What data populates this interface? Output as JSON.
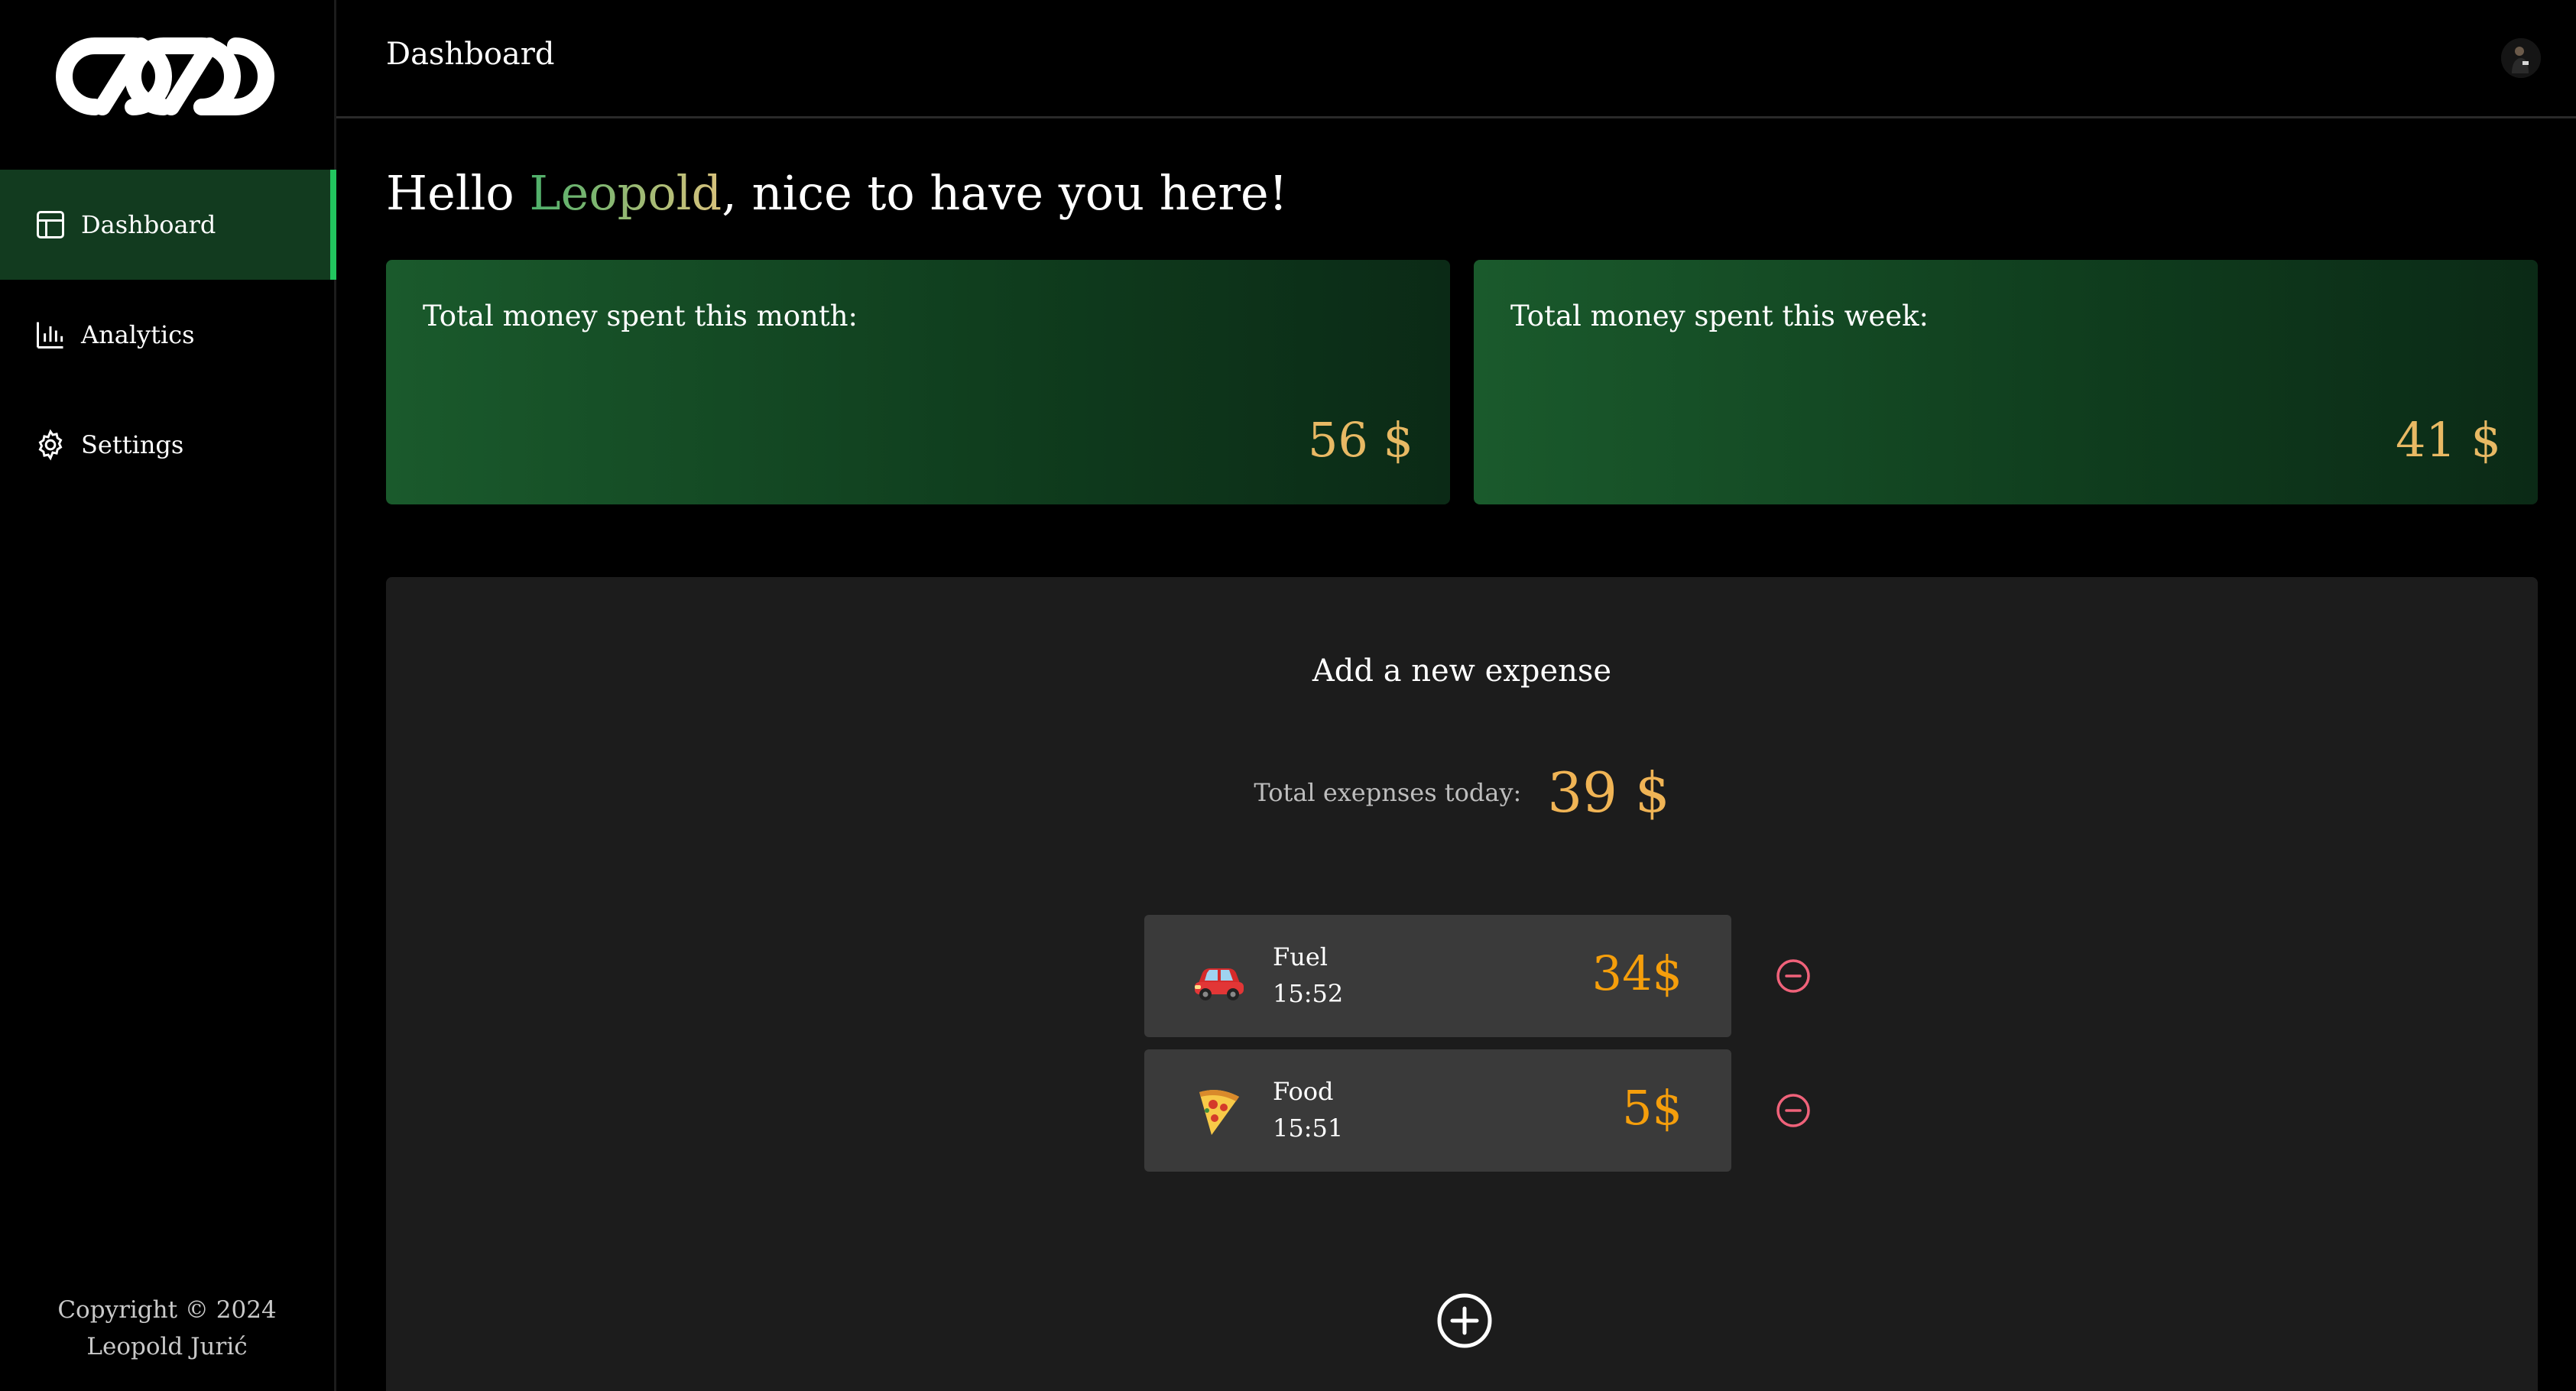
{
  "header": {
    "title": "Dashboard"
  },
  "sidebar": {
    "items": [
      {
        "label": "Dashboard",
        "icon": "layout-icon",
        "active": true
      },
      {
        "label": "Analytics",
        "icon": "bar-chart-icon",
        "active": false
      },
      {
        "label": "Settings",
        "icon": "gear-icon",
        "active": false
      }
    ],
    "copyright_line1": "Copyright © 2024",
    "copyright_line2": "Leopold Jurić"
  },
  "greeting": {
    "prefix": "Hello ",
    "name": "Leopold",
    "suffix": ", nice to have you here!"
  },
  "stats": {
    "month": {
      "label": "Total money spent this month:",
      "value": "56 $"
    },
    "week": {
      "label": "Total money spent this week:",
      "value": "41 $"
    }
  },
  "expenses": {
    "title": "Add a new expense",
    "today_label": "Total exepnses today:",
    "today_value": "39 $",
    "items": [
      {
        "icon": "car-icon",
        "name": "Fuel",
        "time": "15:52",
        "amount": "34$"
      },
      {
        "icon": "pizza-icon",
        "name": "Food",
        "time": "15:51",
        "amount": "5$"
      }
    ]
  },
  "colors": {
    "accent": "#22c55e",
    "active_bg": "#123b1f",
    "amount": "#f59e0b",
    "stat_value": "#e8b964",
    "remove": "#f0627a"
  }
}
